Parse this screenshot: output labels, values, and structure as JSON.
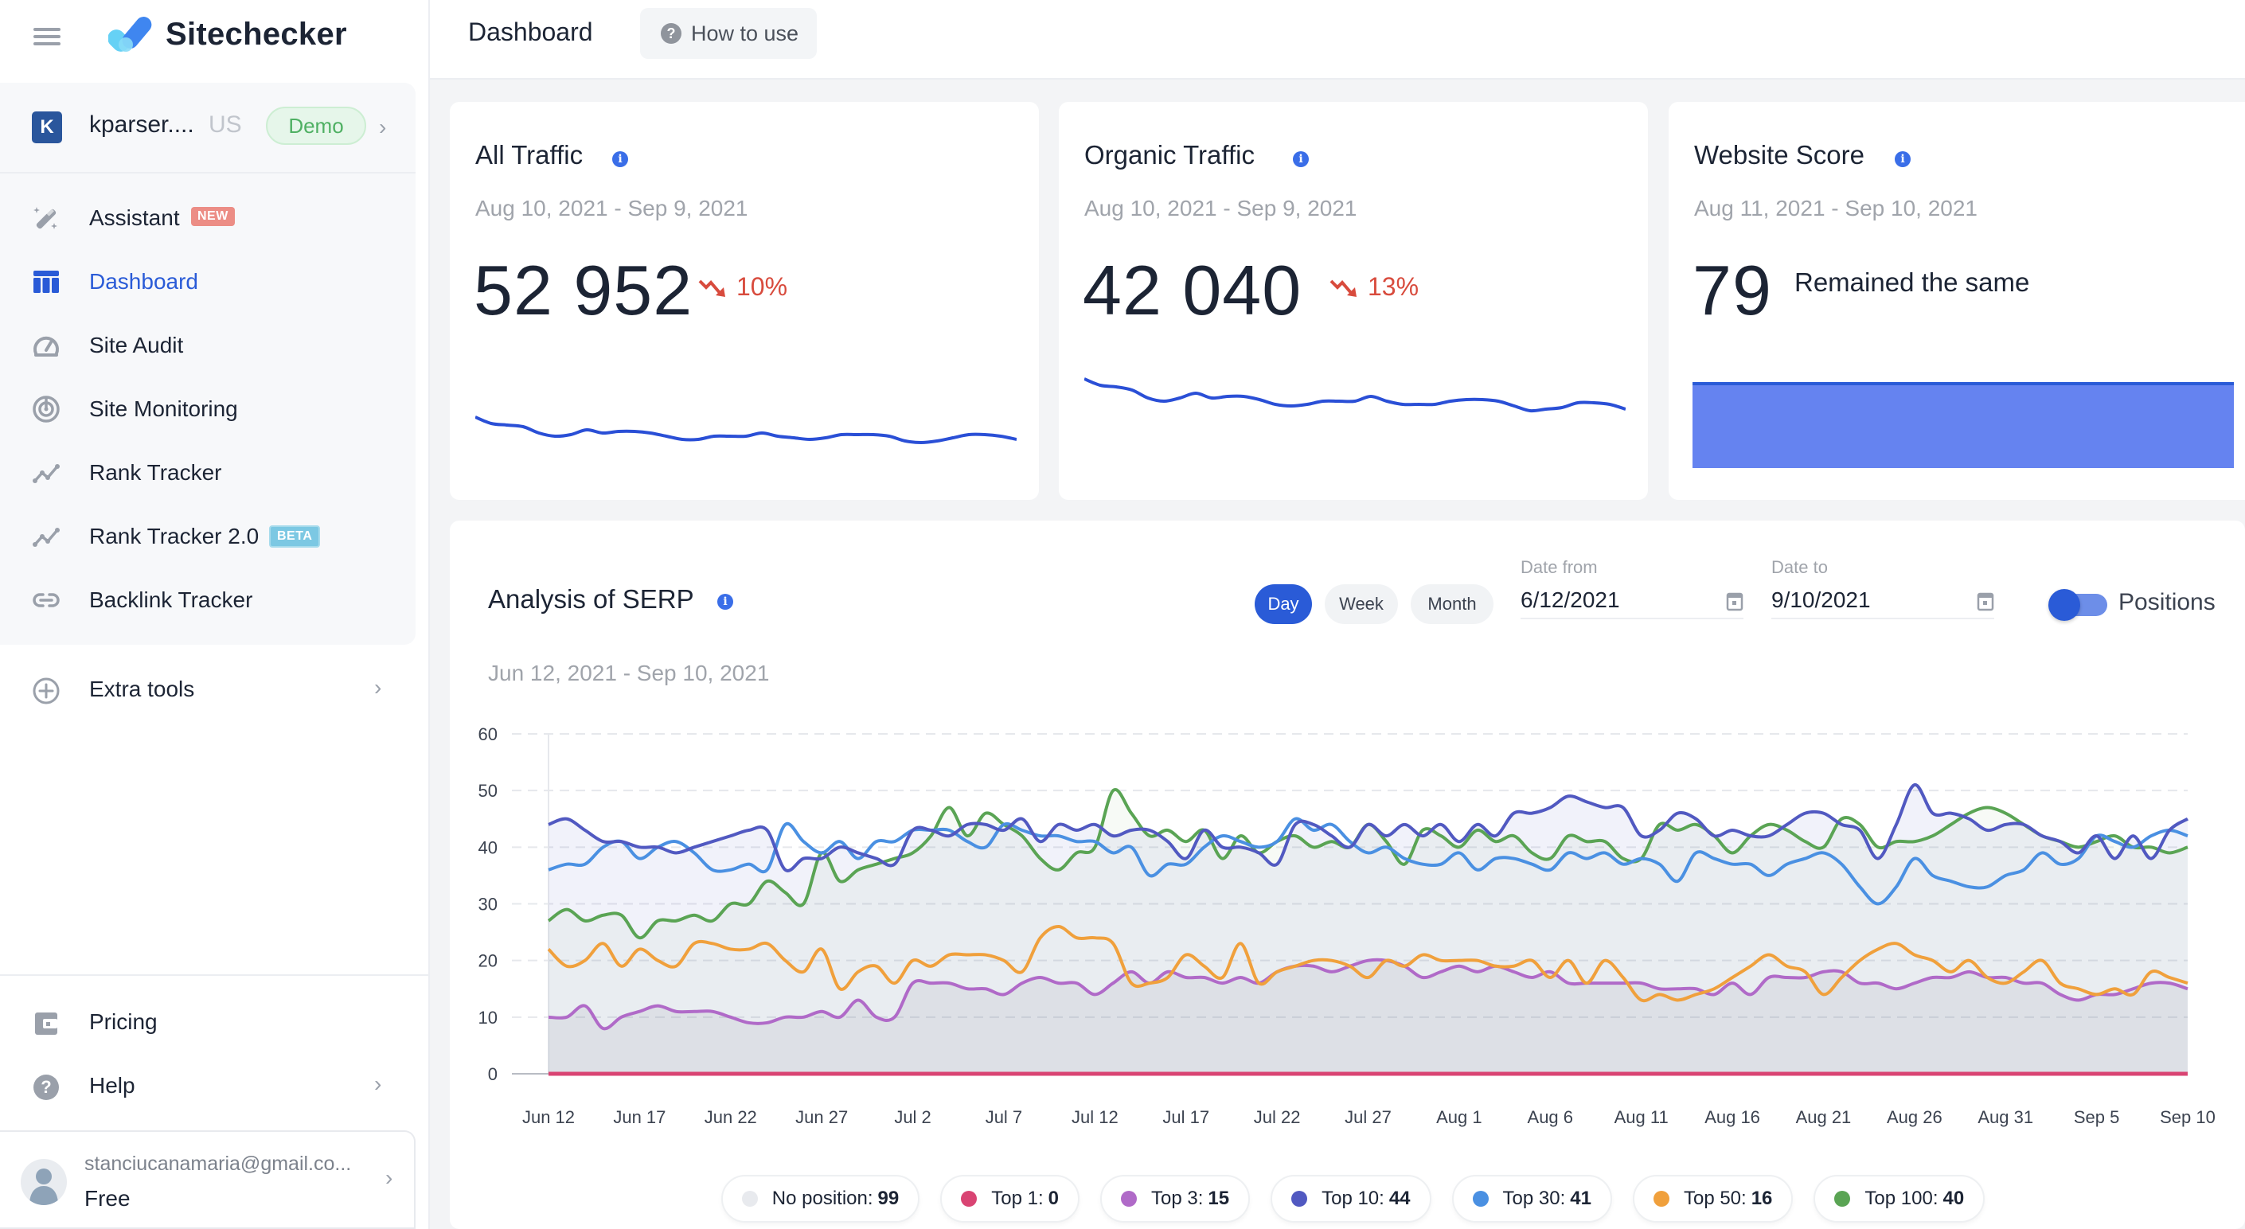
{
  "app": {
    "brand": "Sitechecker",
    "page_title": "Dashboard",
    "how_to_use": "How to use"
  },
  "project": {
    "avatar_letter": "K",
    "name": "kparser....",
    "region": "US",
    "badge": "Demo"
  },
  "sidebar": {
    "items": [
      {
        "label": "Assistant",
        "icon": "magic-wand-icon",
        "badge": "NEW"
      },
      {
        "label": "Dashboard",
        "icon": "dashboard-icon",
        "active": true
      },
      {
        "label": "Site Audit",
        "icon": "speedometer-icon"
      },
      {
        "label": "Site Monitoring",
        "icon": "monitoring-icon"
      },
      {
        "label": "Rank Tracker",
        "icon": "trend-line-icon"
      },
      {
        "label": "Rank Tracker 2.0",
        "icon": "trend-line-icon",
        "badge": "BETA"
      },
      {
        "label": "Backlink Tracker",
        "icon": "link-icon"
      }
    ],
    "extra_tools": "Extra tools",
    "pricing": "Pricing",
    "help": "Help",
    "user": {
      "email": "stanciucanamaria@gmail.co...",
      "plan": "Free"
    }
  },
  "cards": {
    "all_traffic": {
      "title": "All Traffic",
      "date_range": "Aug 10, 2021 - Sep 9, 2021",
      "value": "52 952",
      "delta": "10%",
      "trend": "down",
      "sparkline": [
        62,
        58,
        57,
        56,
        52,
        50,
        51,
        54,
        52,
        53,
        53,
        52,
        50,
        48,
        48,
        50,
        50,
        50,
        52,
        50,
        49,
        48,
        49,
        51,
        51,
        51,
        50,
        47,
        46,
        47,
        49,
        51,
        51,
        50,
        48
      ]
    },
    "organic_traffic": {
      "title": "Organic Traffic",
      "date_range": "Aug 10, 2021 - Sep 9, 2021",
      "value": "42 040",
      "delta": "13%",
      "trend": "down",
      "sparkline": [
        66,
        62,
        61,
        59,
        54,
        52,
        54,
        57,
        54,
        55,
        55,
        53,
        50,
        49,
        50,
        52,
        52,
        52,
        55,
        52,
        50,
        50,
        50,
        52,
        53,
        53,
        52,
        49,
        46,
        47,
        48,
        51,
        51,
        50,
        47
      ]
    },
    "website_score": {
      "title": "Website Score",
      "date_range": "Aug 11, 2021 - Sep 10, 2021",
      "value": "79",
      "status": "Remained the same",
      "bar_color": "#6583f0"
    }
  },
  "serp": {
    "title": "Analysis of SERP",
    "date_range": "Jun 12, 2021 - Sep 10, 2021",
    "periods": [
      "Day",
      "Week",
      "Month"
    ],
    "active_period": "Day",
    "date_from_label": "Date from",
    "date_from": "6/12/2021",
    "date_to_label": "Date to",
    "date_to": "9/10/2021",
    "toggle_label": "Positions",
    "toggle_on": true
  },
  "legend": [
    {
      "label": "No position",
      "value": "99",
      "color": "#e8eaee"
    },
    {
      "label": "Top 1",
      "value": "0",
      "color": "#d94473"
    },
    {
      "label": "Top 3",
      "value": "15",
      "color": "#b06ac8"
    },
    {
      "label": "Top 10",
      "value": "44",
      "color": "#5159c1"
    },
    {
      "label": "Top 30",
      "value": "41",
      "color": "#4a90e2"
    },
    {
      "label": "Top 50",
      "value": "16",
      "color": "#f0a03c"
    },
    {
      "label": "Top 100",
      "value": "40",
      "color": "#5aa454"
    }
  ],
  "chart_data": {
    "type": "line",
    "title": "Analysis of SERP",
    "xlabel": "",
    "ylabel": "",
    "ylim": [
      0,
      60
    ],
    "yticks": [
      0,
      10,
      20,
      30,
      40,
      50,
      60
    ],
    "xtick_labels": [
      "Jun 12",
      "Jun 17",
      "Jun 22",
      "Jun 27",
      "Jul 2",
      "Jul 7",
      "Jul 12",
      "Jul 17",
      "Jul 22",
      "Jul 27",
      "Aug 1",
      "Aug 6",
      "Aug 11",
      "Aug 16",
      "Aug 21",
      "Aug 26",
      "Aug 31",
      "Sep 5",
      "Sep 10"
    ],
    "x_start": "Jun 12, 2021",
    "x_end": "Sep 10, 2021",
    "points_per_series": 91,
    "grid": true,
    "legend_position": "bottom",
    "series": [
      {
        "name": "Top 1",
        "color": "#d94473",
        "values": [
          0,
          0,
          0,
          0,
          0,
          0,
          0,
          0,
          0,
          0,
          0,
          0,
          0,
          0,
          0,
          0,
          0,
          0,
          0,
          0,
          0,
          0,
          0,
          0,
          0,
          0,
          0,
          0,
          0,
          0,
          0,
          0,
          0,
          0,
          0,
          0,
          0,
          0,
          0,
          0,
          0,
          0,
          0,
          0,
          0,
          0,
          0,
          0,
          0,
          0,
          0,
          0,
          0,
          0,
          0,
          0,
          0,
          0,
          0,
          0,
          0,
          0,
          0,
          0,
          0,
          0,
          0,
          0,
          0,
          0,
          0,
          0,
          0,
          0,
          0,
          0,
          0,
          0,
          0,
          0,
          0,
          0,
          0,
          0,
          0,
          0,
          0,
          0,
          0,
          0,
          0
        ]
      },
      {
        "name": "Top 3",
        "color": "#b06ac8",
        "values": [
          10,
          10,
          12,
          8,
          10,
          11,
          12,
          11,
          11,
          11,
          10,
          9,
          9,
          10,
          10,
          11,
          10,
          13,
          10,
          10,
          16,
          16,
          16,
          15,
          15,
          14,
          16,
          17,
          16,
          16,
          14,
          16,
          18,
          16,
          18,
          17,
          17,
          16,
          17,
          16,
          18,
          19,
          19,
          18,
          19,
          20,
          20,
          19,
          17,
          18,
          19,
          18,
          19,
          18,
          17,
          18,
          16,
          16,
          16,
          16,
          16,
          15,
          15,
          15,
          14,
          16,
          14,
          17,
          17,
          17,
          18,
          18,
          16,
          16,
          15,
          16,
          17,
          17,
          18,
          17,
          17,
          16,
          16,
          14,
          13,
          14,
          14,
          15,
          16,
          16,
          15
        ]
      },
      {
        "name": "Top 10",
        "color": "#5159c1",
        "values": [
          44,
          45,
          43,
          41,
          41,
          40,
          40,
          39,
          40,
          41,
          42,
          43,
          43,
          36,
          38,
          38,
          40,
          39,
          38,
          37,
          43,
          43,
          42,
          44,
          44,
          43,
          45,
          41,
          44,
          43,
          44,
          42,
          43,
          43,
          41,
          38,
          43,
          40,
          40,
          39,
          37,
          44,
          44,
          42,
          40,
          44,
          42,
          44,
          42,
          44,
          41,
          44,
          42,
          46,
          46,
          47,
          49,
          48,
          47,
          47,
          42,
          43,
          46,
          45,
          42,
          43,
          42,
          42,
          44,
          46,
          46,
          44,
          43,
          38,
          44,
          51,
          46,
          46,
          45,
          43,
          44,
          44,
          42,
          41,
          39,
          42,
          38,
          42,
          38,
          43,
          45
        ]
      },
      {
        "name": "Top 30",
        "color": "#4a90e2",
        "values": [
          36,
          37,
          37,
          40,
          41,
          38,
          40,
          41,
          39,
          36,
          36,
          37,
          36,
          44,
          41,
          39,
          41,
          38,
          41,
          41,
          43,
          43,
          43,
          41,
          40,
          44,
          43,
          42,
          42,
          41,
          41,
          39,
          40,
          35,
          37,
          37,
          40,
          42,
          41,
          40,
          41,
          45,
          43,
          44,
          41,
          39,
          40,
          38,
          37,
          37,
          39,
          36,
          38,
          38,
          37,
          36,
          39,
          38,
          39,
          37,
          38,
          37,
          34,
          39,
          38,
          37,
          37,
          35,
          37,
          38,
          39,
          37,
          33,
          30,
          33,
          38,
          35,
          34,
          33,
          33,
          35,
          36,
          39,
          37,
          38,
          42,
          41,
          40,
          42,
          43,
          42
        ]
      },
      {
        "name": "Top 50",
        "color": "#f0a03c",
        "values": [
          22,
          19,
          20,
          23,
          19,
          22,
          20,
          19,
          23,
          23,
          22,
          22,
          23,
          20,
          18,
          22,
          15,
          18,
          19,
          16,
          20,
          19,
          21,
          21,
          21,
          20,
          18,
          24,
          26,
          24,
          24,
          23,
          16,
          16,
          17,
          21,
          19,
          17,
          23,
          16,
          18,
          19,
          20,
          20,
          19,
          17,
          20,
          19,
          21,
          20,
          20,
          20,
          19,
          19,
          20,
          17,
          20,
          16,
          20,
          17,
          13,
          14,
          13,
          14,
          15,
          17,
          19,
          21,
          19,
          18,
          14,
          17,
          20,
          22,
          23,
          21,
          20,
          18,
          20,
          17,
          16,
          18,
          20,
          16,
          15,
          14,
          15,
          14,
          18,
          17,
          16
        ]
      },
      {
        "name": "Top 100",
        "color": "#5aa454",
        "values": [
          27,
          29,
          27,
          28,
          28,
          24,
          27,
          27,
          28,
          27,
          30,
          30,
          34,
          32,
          30,
          39,
          34,
          36,
          37,
          38,
          39,
          42,
          47,
          42,
          46,
          44,
          42,
          38,
          36,
          39,
          40,
          50,
          46,
          42,
          43,
          41,
          43,
          38,
          42,
          39,
          41,
          42,
          40,
          41,
          40,
          44,
          41,
          37,
          43,
          42,
          40,
          43,
          41,
          42,
          39,
          38,
          42,
          41,
          41,
          38,
          38,
          44,
          43,
          44,
          42,
          39,
          42,
          44,
          43,
          41,
          40,
          45,
          44,
          40,
          41,
          41,
          42,
          44,
          46,
          47,
          46,
          44,
          42,
          41,
          40,
          41,
          42,
          40,
          40,
          39,
          40
        ]
      },
      {
        "name": "No position",
        "color": "#e8eaee",
        "values": []
      }
    ]
  }
}
